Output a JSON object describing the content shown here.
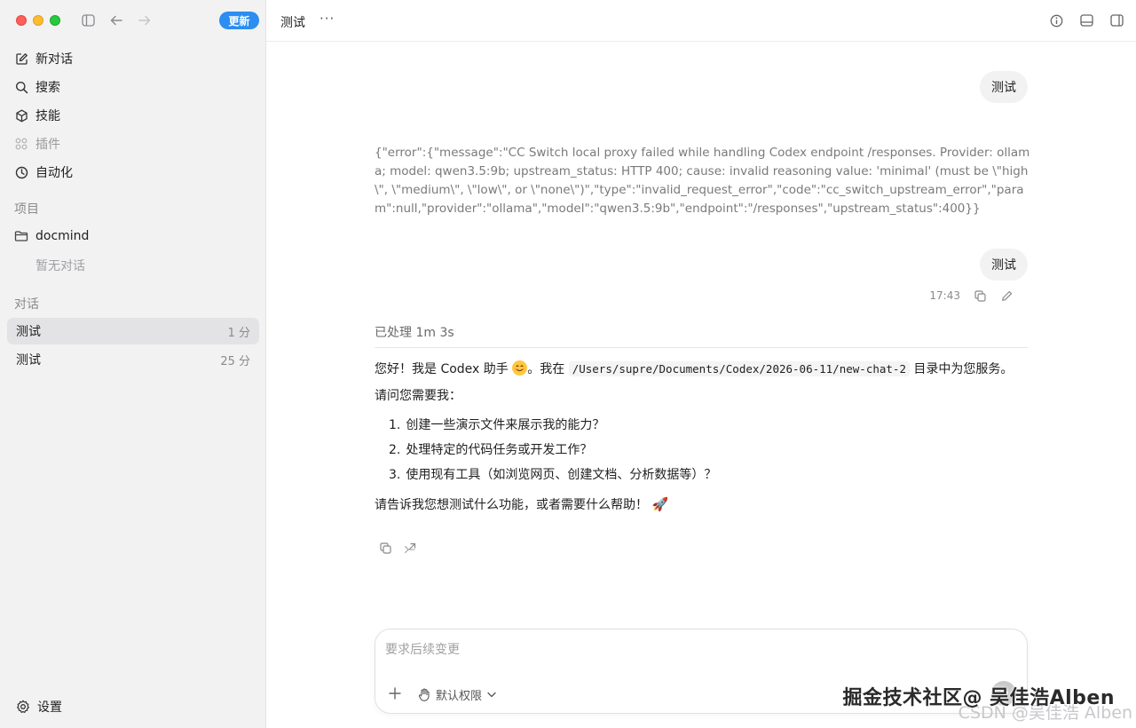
{
  "sidebar": {
    "update_label": "更新",
    "nav": [
      {
        "label": "新对话",
        "icon": "compose-icon"
      },
      {
        "label": "搜索",
        "icon": "search-icon"
      },
      {
        "label": "技能",
        "icon": "cube-icon"
      },
      {
        "label": "插件",
        "icon": "grid-icon"
      },
      {
        "label": "自动化",
        "icon": "clock-icon"
      }
    ],
    "projects_label": "项目",
    "project_name": "docmind",
    "project_empty": "暂无对话",
    "conversations_label": "对话",
    "conversations": [
      {
        "title": "测试",
        "time": "1 分"
      },
      {
        "title": "测试",
        "time": "25 分"
      }
    ],
    "settings_label": "设置"
  },
  "header": {
    "title": "测试",
    "more": "···"
  },
  "chat": {
    "user_msg_1": "测试",
    "error_text": "{\"error\":{\"message\":\"CC Switch local proxy failed while handling Codex endpoint /responses. Provider: ollama; model: qwen3.5:9b; upstream_status: HTTP 400; cause: invalid reasoning value: 'minimal' (must be \\\"high\\\", \\\"medium\\\", \\\"low\\\", or \\\"none\\\")\",\"type\":\"invalid_request_error\",\"code\":\"cc_switch_upstream_error\",\"param\":null,\"provider\":\"ollama\",\"model\":\"qwen3.5:9b\",\"endpoint\":\"/responses\",\"upstream_status\":400}}",
    "user_msg_2": "测试",
    "user_msg_2_time": "17:43",
    "processed": "已处理 1m 3s",
    "reply": {
      "intro_a": "您好！我是 Codex 助手 ",
      "intro_b": "。我在 ",
      "path": "/Users/supre/Documents/Codex/2026-06-11/new-chat-2",
      "intro_c": " 目录中为您服务。",
      "ask": "请问您需要我：",
      "items": [
        {
          "num": "1.",
          "text": "创建一些演示文件来展示我的能力？"
        },
        {
          "num": "2.",
          "text": "处理特定的代码任务或开发工作？"
        },
        {
          "num": "3.",
          "text": "使用现有工具（如浏览网页、创建文档、分析数据等）？"
        }
      ],
      "closing": "请告诉我您想测试什么功能，或者需要什么帮助！",
      "rocket": "🚀"
    }
  },
  "composer": {
    "placeholder": "要求后续变更",
    "permission_label": "默认权限"
  },
  "watermark": {
    "primary": "掘金技术社区@ 吴佳浩Alben",
    "secondary": "CSDN @吴佳浩 Alben"
  }
}
